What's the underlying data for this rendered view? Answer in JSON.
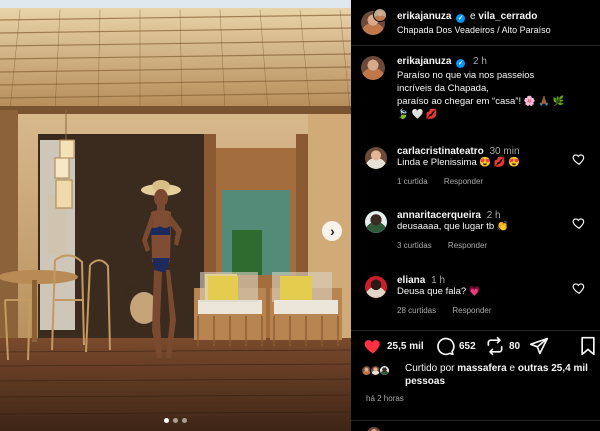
{
  "post": {
    "author": "erikajanuza",
    "collab_joiner": "e",
    "collaborator": "vila_cerrado",
    "location": "Chapada Dos Veadeiros / Alto Paraíso"
  },
  "caption": {
    "author": "erikajanuza",
    "time": "2 h",
    "line1": "Paraíso no que via nos passeios",
    "line2": "incríveis da Chapada,",
    "line3": "paraíso ao chegar em “casa”! 🌸 🙏🏾 🌿",
    "line4": "🍃 🤍 💋"
  },
  "comments": [
    {
      "user": "carlacristinateatro",
      "time": "30 min",
      "text": "Linda e Plenissima 😍 💋 😍",
      "likes": "1 curtida",
      "reply": "Responder"
    },
    {
      "user": "annaritacerqueira",
      "time": "2 h",
      "text": "deusaaaa, que lugar tb 👏",
      "likes": "3 curtidas",
      "reply": "Responder"
    },
    {
      "user": "eliana",
      "time": "1 h",
      "text": "Deusa que fala? 💗",
      "likes": "28 curtidas",
      "reply": "Responder"
    }
  ],
  "actions": {
    "likes": "25,5 mil",
    "comments": "652",
    "reposts": "80"
  },
  "liked_by": {
    "prefix": "Curtido por",
    "user": "massafera",
    "suffix": "e",
    "others": "outras 25,4 mil pessoas"
  },
  "posted_ago": "há 2 horas",
  "colors": {
    "background": "#000000",
    "text": "#f5f5f5",
    "muted": "#a8a8a8",
    "verified": "#0095f6",
    "like_red": "#ff3040"
  },
  "icons": [
    "verified-icon",
    "heart-icon",
    "comment-icon",
    "repost-icon",
    "share-icon",
    "bookmark-icon",
    "chevron-right-icon"
  ]
}
